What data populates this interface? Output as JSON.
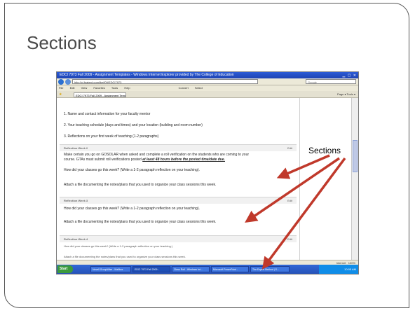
{
  "slide": {
    "title": "Sections",
    "callout_label": "Sections"
  },
  "browser": {
    "window_title": "EDCI 7973 Fall 2009 - Assignment Templates - Windows Internet Explorer provided by The College of Education",
    "address": "http://ci.fsaterd.com/ike/f09/EDCI7973",
    "search_placeholder": "Google",
    "menu": [
      "File",
      "Edit",
      "View",
      "Favorites",
      "Tools",
      "Help"
    ],
    "menu_right": [
      "Convert",
      "Select"
    ],
    "tab_label": "EDCI 7973 Fall 2009 - Assignment Templates",
    "toolbar_right": "Page ▾  Tools ▾",
    "status_text": "Internet",
    "zoom": "100%"
  },
  "content": {
    "intro_lines": [
      "1. Name and contact information for your faculty mentor",
      "2. Your teaching schedule (days and times) and your location (building and room number)",
      "3. Reflections on your first week of teaching (1-2 paragraphs)"
    ],
    "edit_label": "Edit",
    "week2": {
      "header": "Reflection Week 2",
      "line1": "Make certain you go on GOSOLAR when asked and complete a roll verification on the students who are coming to your",
      "line2_prefix": "course.  GTAs must submit roll verifications posted",
      "line2_emphasis": "at least 48 hours before the posted time/date due.",
      "line3": "How did your classes go this week?  (Write a 1-2 paragraph reflection on your teaching).",
      "line4": "Attach a file documenting the notes/plans that you used to organize your class sessions this week."
    },
    "week3": {
      "header": "Reflection Week 3",
      "line1": "How did your classes go this week?  (Write a 1-2 paragraph reflection on your teaching).",
      "line2": "Attach a file documenting the notes/plans that you used to organize your class sessions this week."
    },
    "week4": {
      "header": "Reflection Week 4",
      "line1": "How did your classes go this week?  (Write a 1-2 paragraph reflection on your teaching.)",
      "line2": "Attach a file documenting the notes/plans that you used to organize your class sessions this week."
    }
  },
  "taskbar": {
    "start": "Start",
    "items": [
      "Novell GroupWise - Mailbox",
      "EDCI 7973 Fall 2009 -",
      "Class Roll - Windows Int...",
      "Microsoft PowerPoint -",
      "The Expert Method | S..."
    ],
    "clock": "10:05 AM"
  },
  "colors": {
    "arrow": "#c0392b",
    "titlebar": "#2b5bd6",
    "slide_title": "#4a4a4a"
  }
}
